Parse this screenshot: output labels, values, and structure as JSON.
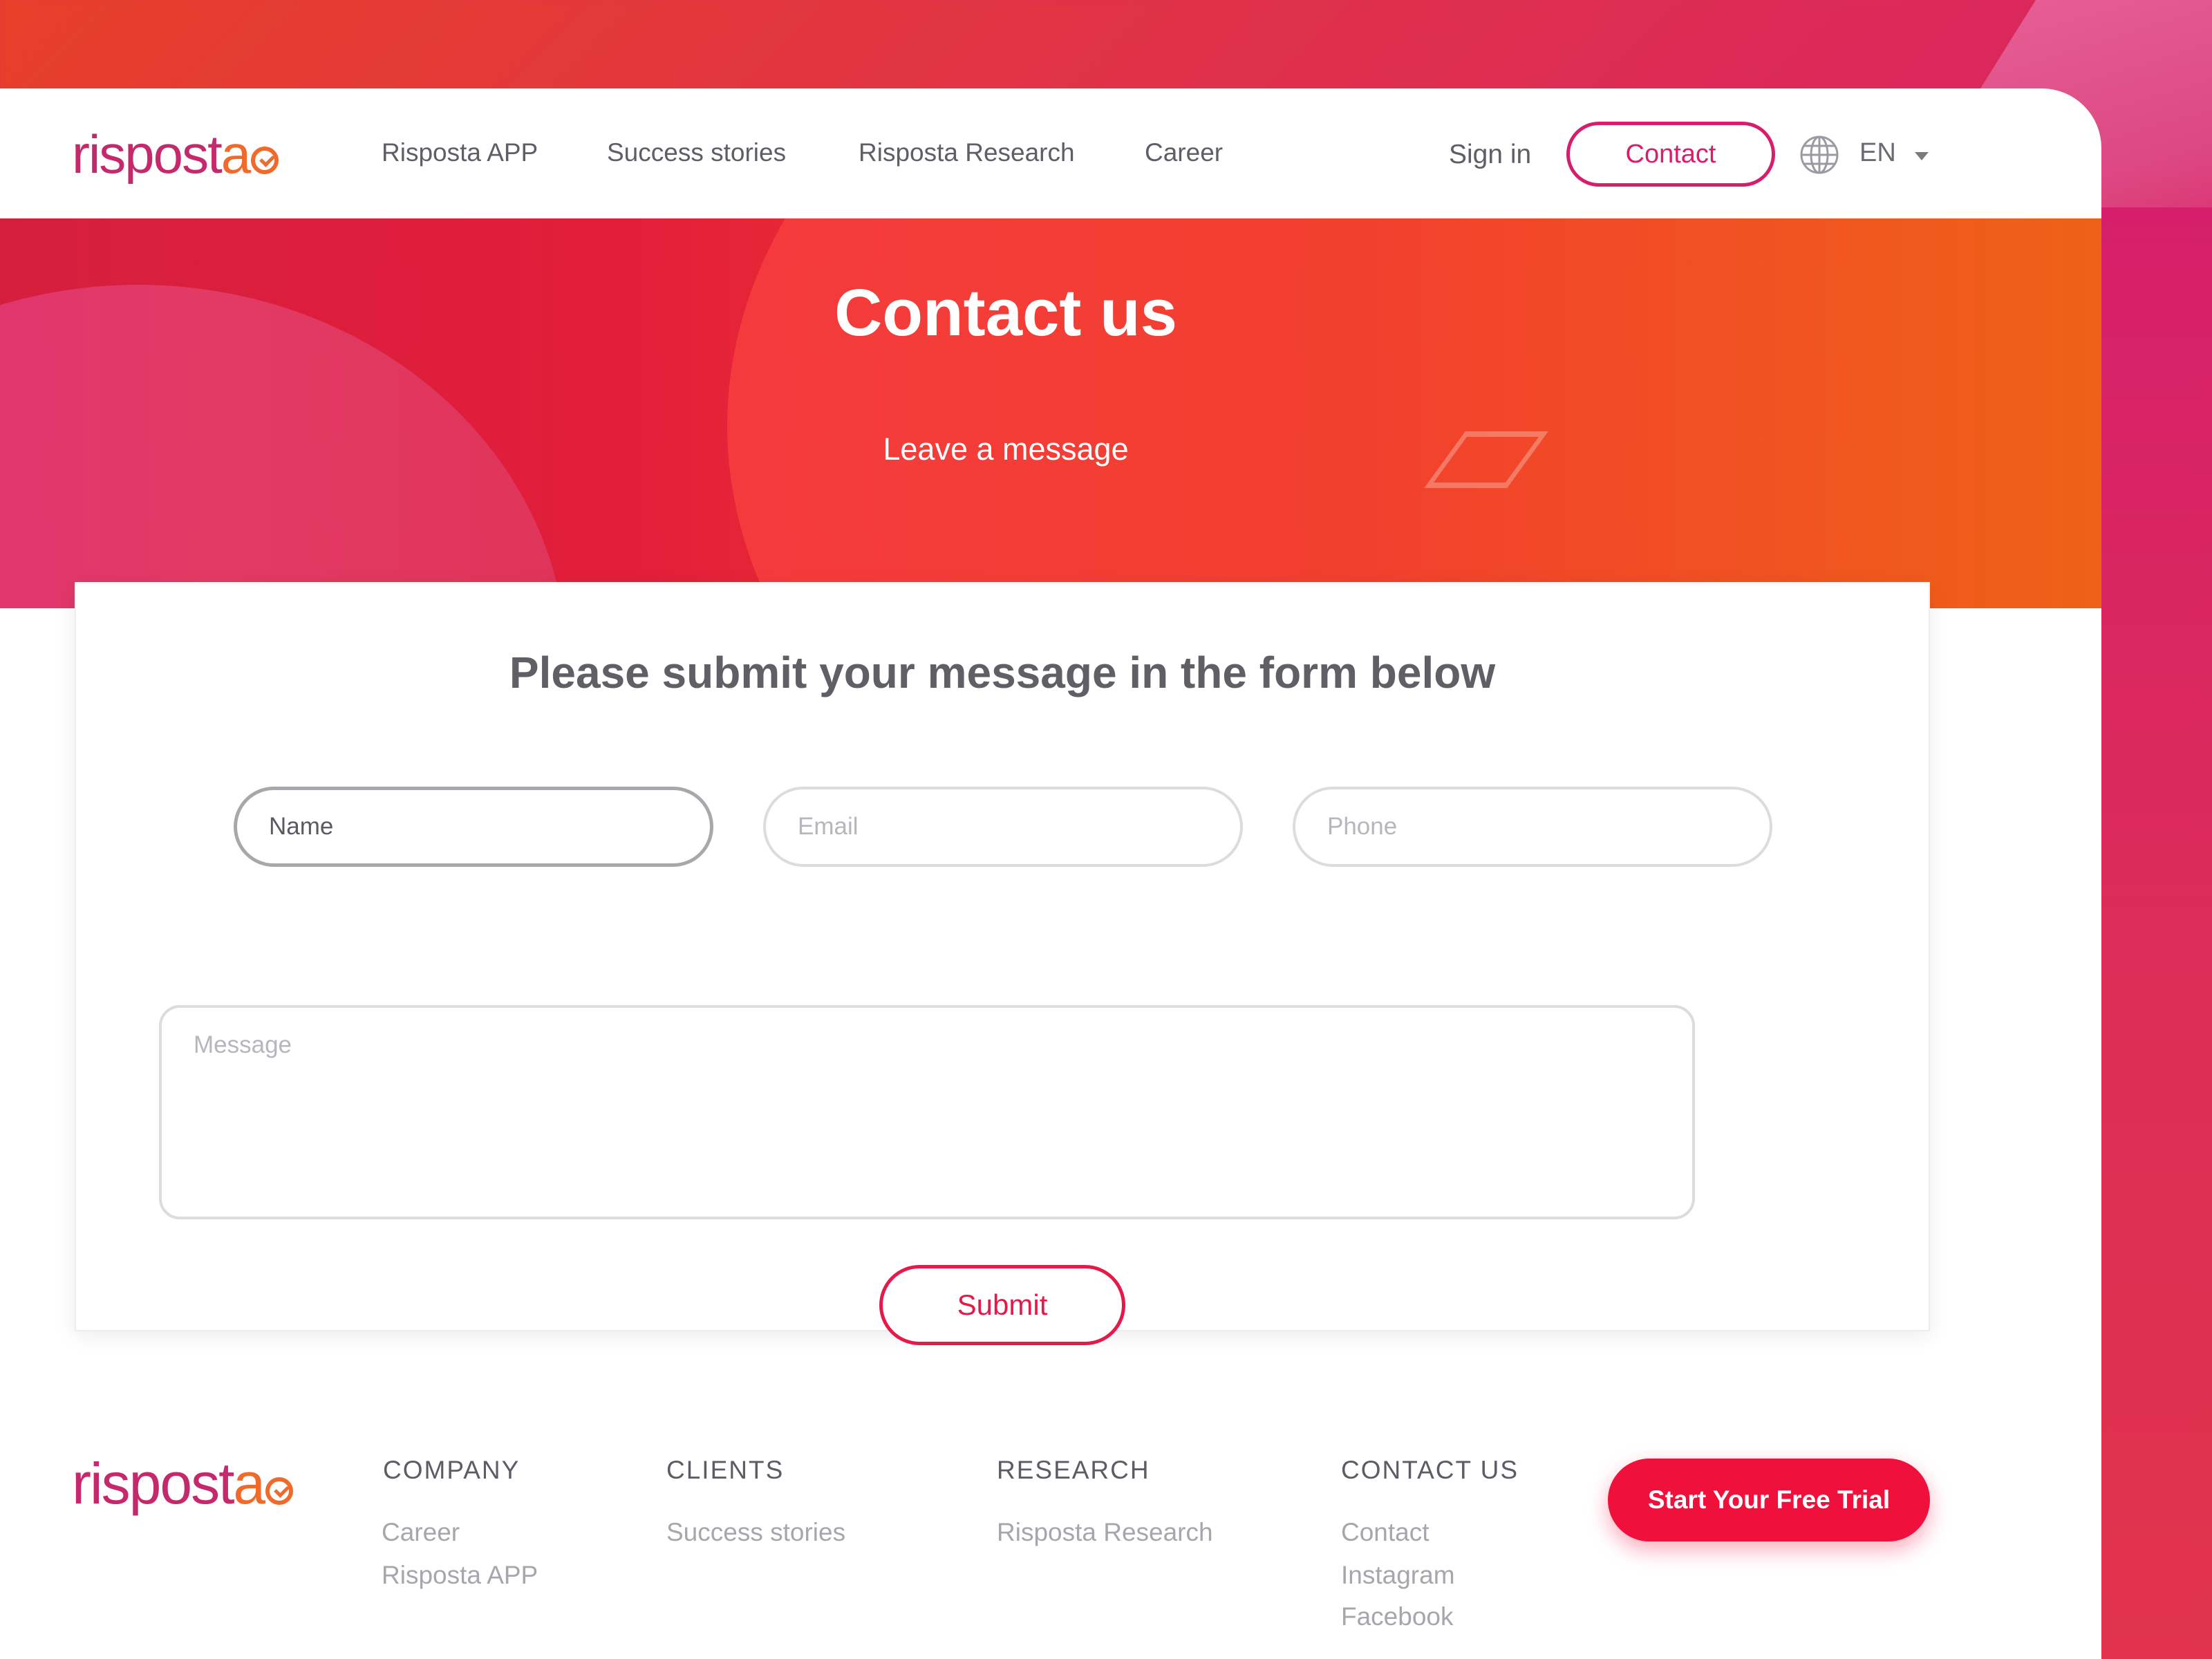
{
  "brand": {
    "logo_text_main": "rispost",
    "logo_text_accent": "a"
  },
  "nav": {
    "links": [
      "Risposta APP",
      "Success stories",
      "Risposta Research",
      "Career"
    ],
    "sign_in": "Sign in",
    "contact": "Contact",
    "language": "EN"
  },
  "hero": {
    "title": "Contact us",
    "subtitle": "Leave a message"
  },
  "form": {
    "title": "Please submit your message in the form below",
    "name_placeholder": "Name",
    "email_placeholder": "Email",
    "phone_placeholder": "Phone",
    "message_placeholder": "Message",
    "submit": "Submit"
  },
  "footer": {
    "columns": [
      {
        "heading": "COMPANY",
        "links": [
          "Career",
          "Risposta APP"
        ]
      },
      {
        "heading": "CLIENTS",
        "links": [
          "Success stories"
        ]
      },
      {
        "heading": "RESEARCH",
        "links": [
          "Risposta Research"
        ]
      },
      {
        "heading": "CONTACT US",
        "links": [
          "Contact",
          "Instagram",
          "Facebook"
        ]
      }
    ],
    "cta": "Start Your Free Trial"
  },
  "colors": {
    "brand_magenta": "#d61e6c",
    "brand_orange": "#f06a2c",
    "cta_red": "#f0103c"
  },
  "icons": [
    "globe-icon",
    "caret-down-icon",
    "logo-check-icon"
  ]
}
